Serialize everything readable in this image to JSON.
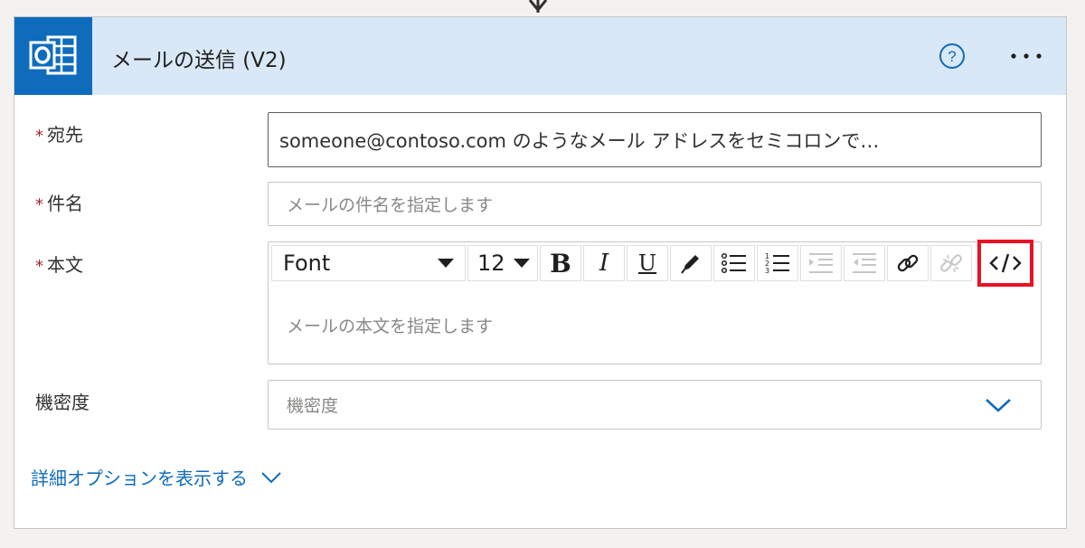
{
  "action": {
    "title": "メールの送信 (V2)",
    "icon": "outlook-icon",
    "help_icon": "help-icon",
    "more_icon": "more-options-icon"
  },
  "fields": {
    "to": {
      "required_mark": "*",
      "label": "宛先",
      "value": "someone@contoso.com のようなメール アドレスをセミコロンで…"
    },
    "subject": {
      "required_mark": "*",
      "label": "件名",
      "placeholder": "メールの件名を指定します"
    },
    "body": {
      "required_mark": "*",
      "label": "本文",
      "placeholder": "メールの本文を指定します",
      "toolbar": {
        "font": "Font",
        "font_size": "12",
        "bold": "B",
        "italic": "I",
        "underline": "U",
        "icons": [
          "pen-icon",
          "bullet-list-icon",
          "numbered-list-icon",
          "increase-indent-icon",
          "decrease-indent-icon",
          "link-icon",
          "unlink-icon",
          "code-view-icon"
        ]
      }
    },
    "sensitivity": {
      "label": "機密度",
      "placeholder": "機密度"
    }
  },
  "advanced_options": "詳細オプションを表示する",
  "colors": {
    "accent": "#0f6cbd",
    "header_bg": "#d9e8f6",
    "required": "#a4262c",
    "highlight": "#e81123"
  }
}
